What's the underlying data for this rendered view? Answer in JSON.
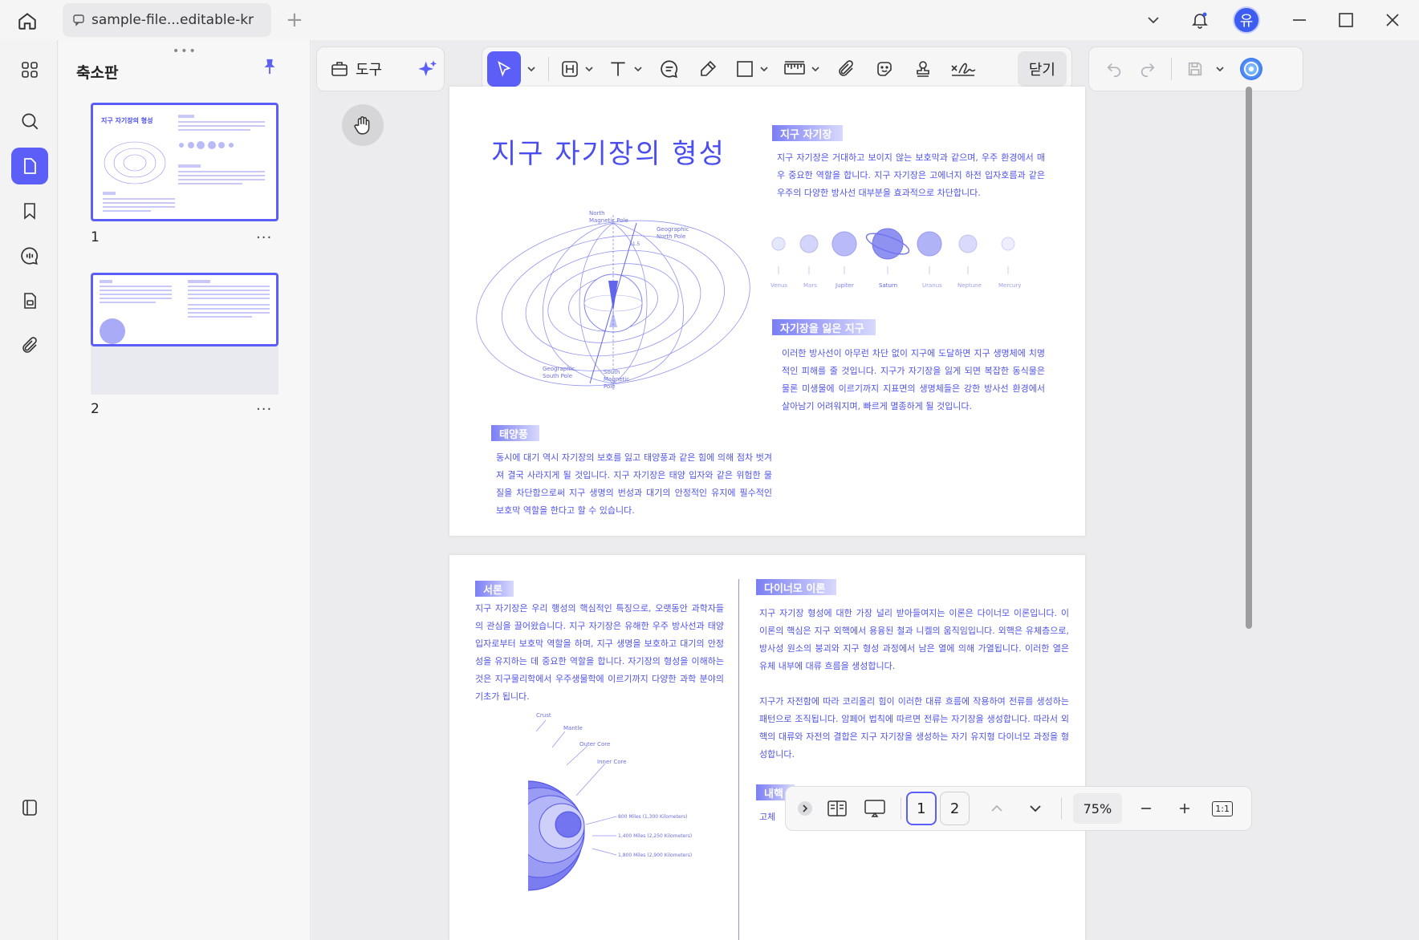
{
  "tab": {
    "title": "sample-file...editable-kr"
  },
  "user": {
    "avatar_initial": "유"
  },
  "thumbnails": {
    "title": "축소판",
    "pages": [
      {
        "number": "1",
        "more": "···",
        "heading": "지구 자기장의 형성"
      },
      {
        "number": "2",
        "more": "···"
      }
    ]
  },
  "toolbar": {
    "tools_label": "도구",
    "close_label": "닫기"
  },
  "page1": {
    "title": "지구 자기장의 형성",
    "sec_magnetic": "지구 자기장",
    "para_magnetic": "지구 자기장은 거대하고 보이지 않는 보호막과 같으며, 우주 환경에서 매우 중요한 역할을 합니다. 지구 자기장은 고에너지 하전 입자호름과 같은 우주의 다양한 방사선 대부분을 효과적으로 차단합니다.",
    "sec_lost": "자기장을 잃은 지구",
    "para_lost": "이러한 방사선이 아무런 차단 없이 지구에 도달하면 지구 생명체에 치명적인 피해를 줄 것입니다. 지구가 자기장을 잃게 되면 복잡한 동식물은 물론 미생물에 이르기까지 지표면의 생명체들은 강한 방사선 환경에서 살아남기 어려워지며, 빠르게 멸종하게 될 것입니다.",
    "sec_solar": "태양풍",
    "para_solar": "동시에 대기 역시 자기장의 보호를 잃고 태양풍과 같은 힘에 의해 점차 벗겨져 결국 사라지게 될 것입니다. 지구 자기장은 태양 입자와 같은 위험한 물질을 차단함으로써 지구 생명의 번성과 대기의 안정적인 유지에 필수적인 보호막 역할을 한다고 할 수 있습니다.",
    "diagram_labels": {
      "north_magnetic": "North\nMagnetic Pole",
      "geo_north": "Geographic\nNorth Pole",
      "geo_south": "Geographic\nSouth Pole",
      "south_magnetic": "South\nMagnetic\nPole",
      "angle": "11.5"
    },
    "planets": [
      "Venus",
      "Mars",
      "Jupiter",
      "Saturn",
      "Uranus",
      "Neptune",
      "Mercury"
    ]
  },
  "page2": {
    "sec_intro": "서론",
    "para_intro": "지구 자기장은 우리 행성의 핵심적인 특징으로, 오랫동안 과학자들의 관심을 끌어왔습니다. 지구 자기장은 유해한 우주 방사선과 태양 입자로부터 보호막 역할을 하며, 지구 생명을 보호하고 대기의 안정성을 유지하는 데 중요한 역할을 합니다. 자기장의 형성을 이해하는 것은 지구물리학에서 우주생물학에 이르기까지 다양한 과학 분야의 기초가 됩니다.",
    "sec_dynamo": "다이너모 이론",
    "para_dynamo1": "지구 자기장 형성에 대한 가장 널리 받아들여지는 이론은 다이너모 이론입니다. 이 이론의 핵심은 지구 외핵에서 용융된 철과 니켈의 움직임입니다. 외핵은 유체층으로, 방사성 원소의 붕괴와 지구 형성 과정에서 남은 열에 의해 가열됩니다. 이러한 열은 유체 내부에 대류 흐름을 생성합니다.",
    "para_dynamo2": "지구가 자전함에 따라 코리올리 힘이 이러한 대류 흐름에 작용하여 전류를 생성하는 패턴으로 조직됩니다. 암페어 법칙에 따르면 전류는 자기장을 생성합니다. 따라서 외핵의 대류와 자전의 결합은 지구 자기장을 생성하는 자기 유지형 다이너모 과정을 형성합니다.",
    "sec_inner": "내핵",
    "para_inner_start": "고체",
    "core_labels": {
      "crust": "Crust",
      "mantle": "Mantle",
      "outer_core": "Outer Core",
      "inner_core": "Inner Core",
      "d1": "800 Miles (1,300 Kilometers)",
      "d2": "1,400 Miles (2,250 Kilometers)",
      "d3": "1,800 Miles (2,900 Kilometers)"
    }
  },
  "bottom_nav": {
    "page_1": "1",
    "page_2": "2",
    "zoom": "75%",
    "fit": "1:1"
  },
  "colors": {
    "accent": "#5b5ff7",
    "doc_text": "#5054e8"
  }
}
